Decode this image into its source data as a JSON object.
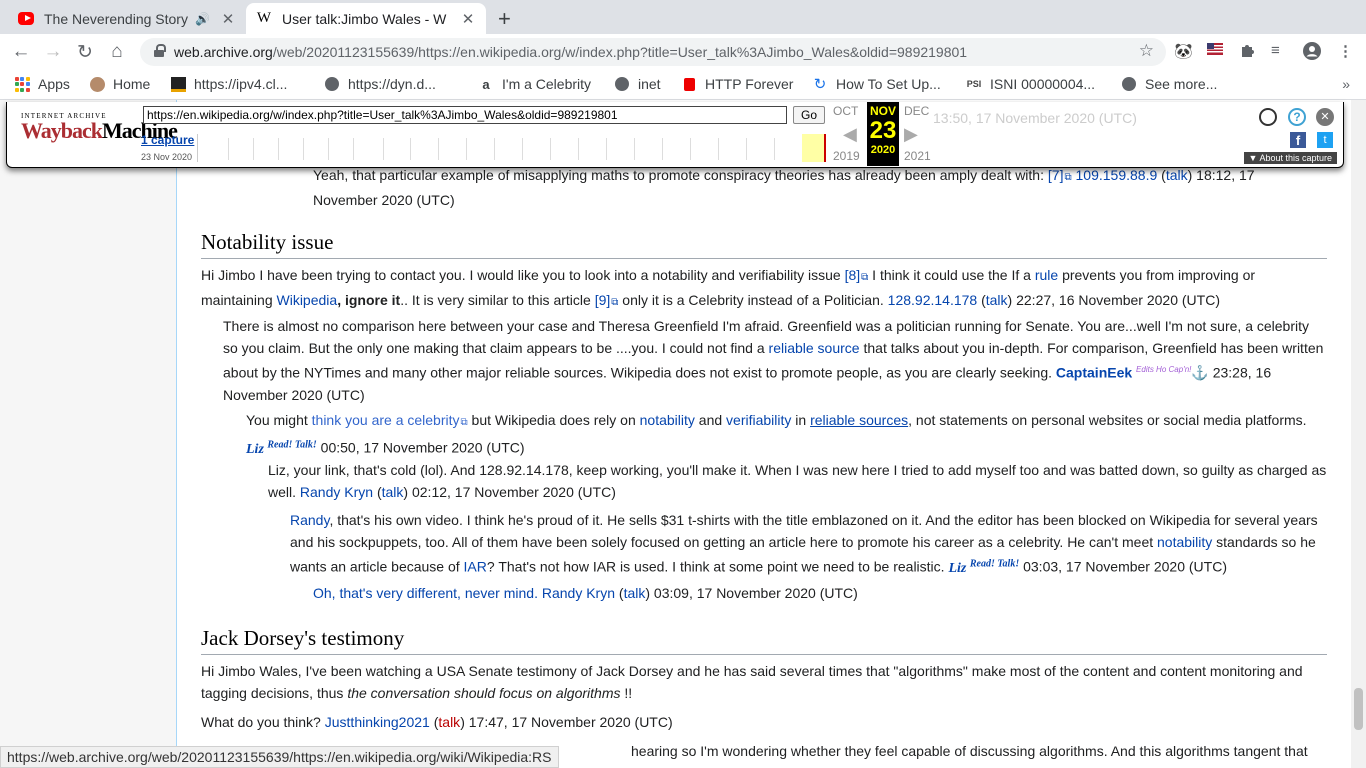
{
  "tabs": [
    {
      "title": "The Neverending Story",
      "favicon": "youtube-icon"
    },
    {
      "title": "User talk:Jimbo Wales - W",
      "favicon": "wikipedia-icon"
    }
  ],
  "omnibox": {
    "url_host": "web.archive.org",
    "url_path": "/web/20201123155639/https://en.wikipedia.org/w/index.php?title=User_talk%3AJimbo_Wales&oldid=989219801"
  },
  "bookmarks": [
    {
      "label": "Apps"
    },
    {
      "label": "Home"
    },
    {
      "label": "https://ipv4.cl..."
    },
    {
      "label": "https://dyn.d..."
    },
    {
      "label": "I'm a Celebrity"
    },
    {
      "label": "inet"
    },
    {
      "label": "HTTP Forever"
    },
    {
      "label": "How To Set Up..."
    },
    {
      "label": "ISNI 00000004..."
    },
    {
      "label": "See more..."
    }
  ],
  "wayback": {
    "logo_top": "INTERNET ARCHIVE",
    "logo_main_a": "Wayback",
    "logo_main_b": "Machine",
    "url": "https://en.wikipedia.org/w/index.php?title=User_talk%3AJimbo_Wales&oldid=989219801",
    "go": "Go",
    "captures": "1 capture",
    "capture_date": "23 Nov 2020",
    "prev_month": "OCT",
    "cur_month": "NOV",
    "next_month": "DEC",
    "day": "23",
    "prev_year": "2019",
    "cur_year": "2020",
    "next_year": "2021",
    "ghost_text": "13:50, 17 November 2020 (UTC)",
    "about": "About this capture"
  },
  "content": {
    "top_reply": {
      "text": "Yeah, that particular example of misapplying maths to promote conspiracy theories has already been amply dealt with: ",
      "link": "[7]",
      "ip": "109.159.88.9",
      "talk": "talk",
      "time": "18:12, 17 November 2020 (UTC)"
    },
    "section1": {
      "heading": "Notability issue",
      "p1_a": "Hi Jimbo I have been trying to contact you. I would like you to look into a notability and verifiability issue ",
      "p1_ref8": "[8]",
      "p1_b": " I think it could use the If a ",
      "p1_rule": "rule",
      "p1_c": " prevents you from improving or maintaining ",
      "p1_wp": "Wikipedia",
      "p1_ignore": ", ignore it",
      "p1_d": ".. It is very similar to this article ",
      "p1_ref9": "[9]",
      "p1_e": " only it is a Celebrity instead of a Politician. ",
      "p1_ip": "128.92.14.178",
      "p1_talk": "talk",
      "p1_time": " 22:27, 16 November 2020 (UTC)",
      "r1_a": "There is almost no comparison here between your case and Theresa Greenfield I'm afraid. Greenfield was a politician running for Senate. You are...well I'm not sure, a celebrity so you claim. But the only one making that claim appears to be ....you. I could not find a ",
      "r1_rs": "reliable source",
      "r1_b": " that talks about you in-depth. For comparison, Greenfield has been written about by the NYTimes and many other major reliable sources. Wikipedia does not exist to promote people, as you are clearly seeking. ",
      "r1_sig": "CaptainEek",
      "r1_sup": "Edits Ho Cap'n!",
      "r1_anchor": "⚓",
      "r1_time": " 23:28, 16 November 2020 (UTC)",
      "r2_a": "You might ",
      "r2_celeb": "think you are a celebrity",
      "r2_b": " but Wikipedia does rely on ",
      "r2_not": "notability",
      "r2_c": " and ",
      "r2_ver": "verifiability",
      "r2_d": " in ",
      "r2_rs": "reliable sources",
      "r2_e": ", not statements on personal websites or social media platforms. ",
      "r2_sig": "Liz",
      "r2_sup": "Read! Talk!",
      "r2_time": " 00:50, 17 November 2020 (UTC)",
      "r3_a": "Liz, your link, that's cold (lol). And 128.92.14.178, keep working, you'll make it. When I was new here I tried to add myself too and was batted down, so guilty as charged as well. ",
      "r3_sig": "Randy Kryn",
      "r3_talk": "talk",
      "r3_time": " 02:12, 17 November 2020 (UTC)",
      "r4_randy": "Randy",
      "r4_a": ", that's his own video. I think he's proud of it. He sells $31 t-shirts with the title emblazoned on it. And the editor has been blocked on Wikipedia for several years and his sockpuppets, too. All of them have been solely focused on getting an article here to promote his career as a celebrity. He can't meet ",
      "r4_not": "notability",
      "r4_b": " standards so he wants an article because of ",
      "r4_iar": "IAR",
      "r4_c": "? That's not how IAR is used. I think at some point we need to be realistic. ",
      "r4_sig": "Liz",
      "r4_sup": "Read! Talk!",
      "r4_time": " 03:03, 17 November 2020 (UTC)",
      "r5_a": "Oh, that's very different, never mind. Randy Kryn",
      "r5_talk": "talk",
      "r5_time": " 03:09, 17 November 2020 (UTC)"
    },
    "section2": {
      "heading": "Jack Dorsey's testimony",
      "p1_a": "Hi Jimbo Wales, I've been watching a USA Senate testimony of Jack Dorsey and he has said several times that \"algorithms\" make most of the content and content monitoring and tagging decisions, thus ",
      "p1_em": "the conversation should focus on algorithms",
      "p1_b": " !!",
      "p2_a": "What do you think? ",
      "p2_user": "Justthinking2021",
      "p2_talk": "talk",
      "p2_time": " 17:47, 17 November 2020 (UTC)",
      "p3_partial": "hearing so I'm wondering whether they feel capable of discussing algorithms. And this algorithms tangent that"
    }
  },
  "status_url": "https://web.archive.org/web/20201123155639/https://en.wikipedia.org/wiki/Wikipedia:RS",
  "colors": {
    "link": "#0645ad",
    "redlink": "#ba0000",
    "wayback_now_bg": "#000000",
    "wayback_now_fg": "#ffff00"
  }
}
